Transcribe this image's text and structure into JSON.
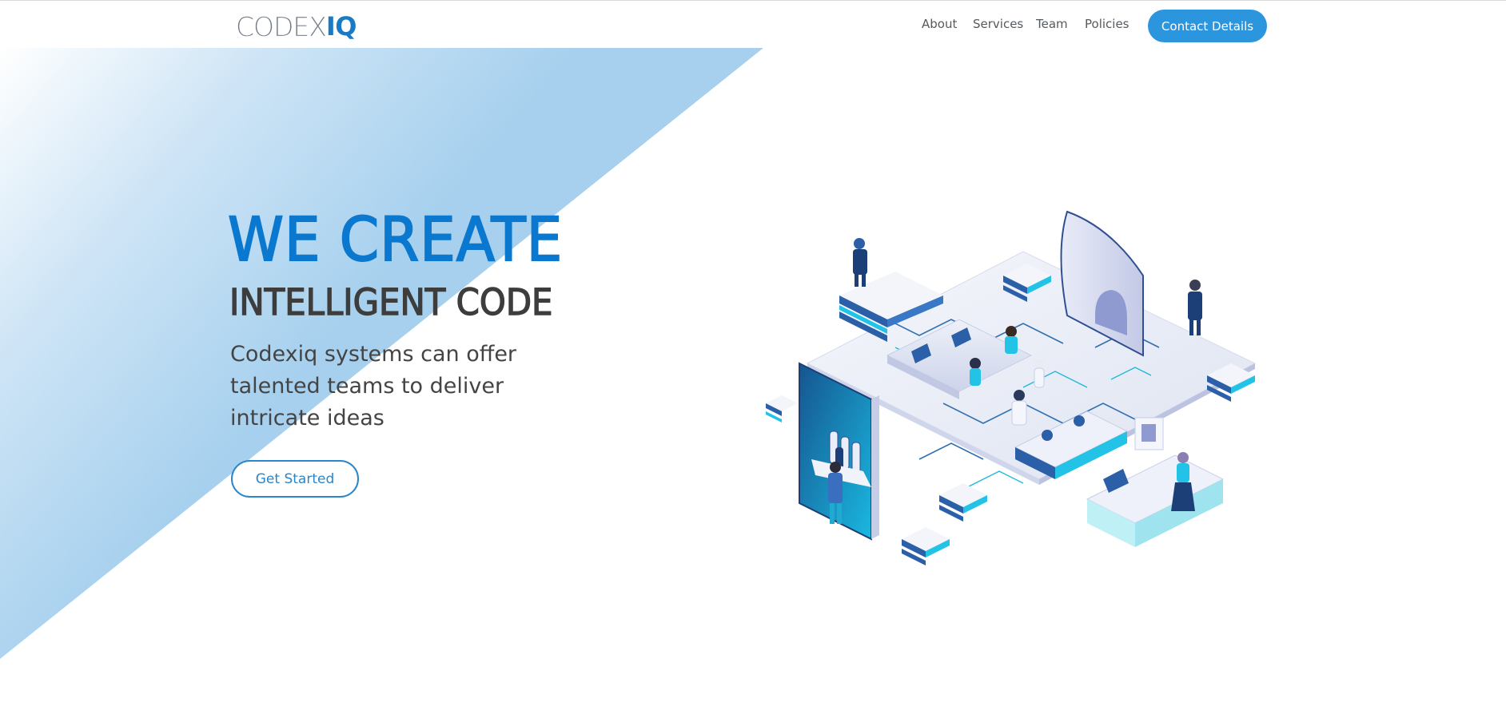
{
  "brand": {
    "logo_light": "CODEX",
    "logo_bold": "IQ"
  },
  "nav": {
    "items": [
      {
        "label": "About"
      },
      {
        "label": "Services"
      },
      {
        "label": "Team"
      },
      {
        "label": "Policies"
      }
    ],
    "contact_label": "Contact Details"
  },
  "hero": {
    "line1": "WE CREATE",
    "line2": "INTELLIGENT CODE",
    "description": "Codexiq systems can offer talented teams to deliver intricate ideas",
    "cta_label": "Get Started"
  },
  "colors": {
    "accent": "#2b95dd",
    "headline_blue": "#0a78cf",
    "headline_dark": "#3d3d3d",
    "triangle_light": "#ffffff",
    "triangle_dark": "#a6d0ee"
  }
}
